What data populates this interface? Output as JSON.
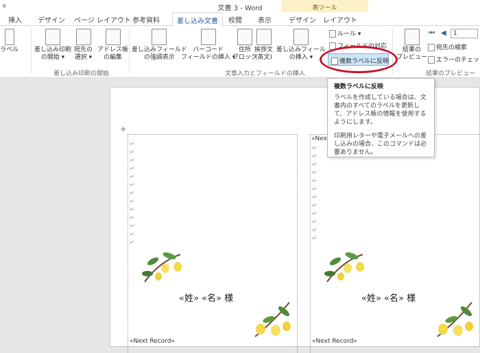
{
  "window": {
    "title": "文書 3 - Word",
    "qat_glyph": "ㅎ"
  },
  "context_group": {
    "label": "表ツール"
  },
  "tabs": [
    "挿入",
    "デザイン",
    "ページ レイアウト",
    "参考資料",
    "差し込み文書",
    "校閲",
    "表示",
    "デザイン",
    "レイアウト"
  ],
  "active_tab_index": 4,
  "ribbon": {
    "partial_label": "ラベル",
    "start": {
      "merge": "差し込み印刷\nの開始 ▾",
      "recipients": "宛先の\n選択 ▾",
      "edit_list": "アドレス帳\nの編集",
      "group": "差し込み印刷の開始"
    },
    "fields": {
      "highlight": "差し込みフィールド\nの強調表示",
      "barcode": "バーコード\nフィールドの挿入 ▾",
      "address": "住所\nブロック",
      "greeting": "挨拶文\n(英文)",
      "insert_field": "差し込みフィール\nの挿入 ▾",
      "rules": "ルール ▾",
      "match": "フィールドの対応",
      "update_labels": "複数ラベルに反映",
      "group": "文章入力とフィールドの挿入"
    },
    "preview": {
      "preview_results": "結果の\nプレビュー",
      "record_value": "1",
      "find_recipient": "宛先の検索",
      "check_errors": "エラーのチェック",
      "group": "結果のプレビュー"
    }
  },
  "tooltip": {
    "title": "複数ラベルに反映",
    "body1": "ラベルを作成している場合は、文書内のすべてのラベルを更新して、アドレス帳の情報を使用するようにします。",
    "body2": "印刷用レターや電子メールへの差し込みの場合、このコマンドは必要ありません。"
  },
  "document": {
    "label_text": "«姓» «名» 様",
    "next_record": "«Next Record»",
    "next_record_partial": "«Nex",
    "para_mark": "↵",
    "table_anchor": "✛"
  },
  "colors": {
    "accent": "#2b579a",
    "highlight": "#cde6f7",
    "ellipse": "#c8102e"
  }
}
